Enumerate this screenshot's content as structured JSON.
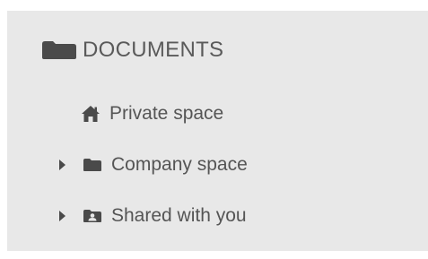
{
  "section": {
    "title": "DOCUMENTS",
    "icon": "folder-icon"
  },
  "items": [
    {
      "label": "Private space",
      "icon": "home-icon",
      "expandable": false
    },
    {
      "label": "Company space",
      "icon": "folder-icon",
      "expandable": true
    },
    {
      "label": "Shared with you",
      "icon": "shared-folder-icon",
      "expandable": true
    }
  ],
  "colors": {
    "panel_background": "#e8e8e8",
    "icon": "#4a4a4a",
    "text": "#555555",
    "header_text": "#5a5a5a"
  }
}
